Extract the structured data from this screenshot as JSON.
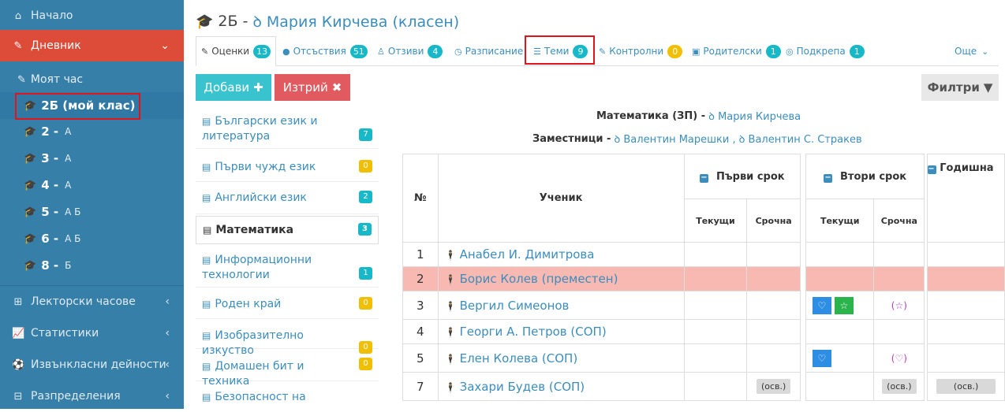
{
  "sidebar": {
    "home": "Начало",
    "diary": "Дневник",
    "my_hour": "Моят час",
    "classes": [
      {
        "num": "2Б (мой клас)",
        "letters": ""
      },
      {
        "num": "2 -",
        "letters": "А"
      },
      {
        "num": "3 -",
        "letters": "А"
      },
      {
        "num": "4 -",
        "letters": "А"
      },
      {
        "num": "5 -",
        "letters": "А Б"
      },
      {
        "num": "6 -",
        "letters": "А Б"
      },
      {
        "num": "8 -",
        "letters": "Б"
      }
    ],
    "lecture": "Лекторски часове",
    "stats": "Статистики",
    "extra": "Извънкласни дейности",
    "distrib": "Разпределения"
  },
  "header": {
    "cls": "2Б -",
    "teacher": "Мария Кирчева (класен)"
  },
  "tabs": [
    {
      "label": "Оценки",
      "badge": "13"
    },
    {
      "label": "Отсъствия",
      "badge": "51"
    },
    {
      "label": "Отзиви",
      "badge": "4"
    },
    {
      "label": "Разписание",
      "badge": ""
    },
    {
      "label": "Теми",
      "badge": "9"
    },
    {
      "label": "Контролни",
      "badge": "0"
    },
    {
      "label": "Родителски",
      "badge": "1"
    },
    {
      "label": "Подкрепа",
      "badge": "1"
    },
    {
      "label": "Още",
      "badge": ""
    }
  ],
  "buttons": {
    "add": "Добави",
    "delete": "Изтрий",
    "filter": "Филтри"
  },
  "subjects": [
    {
      "name": "Български език и литература",
      "badge": "7"
    },
    {
      "name": "Първи чужд език",
      "badge": "0"
    },
    {
      "name": "Английски език",
      "badge": "2"
    },
    {
      "name": "Математика",
      "badge": "3"
    },
    {
      "name": "Информационни технологии",
      "badge": "1"
    },
    {
      "name": "Роден край",
      "badge": "0"
    },
    {
      "name": "Изобразително изкуство",
      "badge": "0"
    },
    {
      "name": "Домашен бит и техника",
      "badge": "0"
    },
    {
      "name": "Безопасност на",
      "badge": ""
    }
  ],
  "subject_info": {
    "label": "Математика (ЗП) -",
    "teacher": "Мария Кирчева",
    "subs_label": "Заместници -",
    "subs1": "Валентин Марешки ,",
    "subs2": "Валентин С. Стракев"
  },
  "table": {
    "h_num": "№",
    "h_student": "Ученик",
    "h_term1": "Първи срок",
    "h_term2": "Втори срок",
    "h_year": "Годишна",
    "h_current": "Текущи",
    "h_term_grade": "Срочна",
    "students": [
      {
        "n": "1",
        "name": "Анабел И. Димитрова"
      },
      {
        "n": "2",
        "name": "Борис Колев (преместен)"
      },
      {
        "n": "3",
        "name": "Вергил Симеонов"
      },
      {
        "n": "4",
        "name": "Георги А. Петров (СОП)"
      },
      {
        "n": "5",
        "name": "Елен Колева (СОП)"
      },
      {
        "n": "7",
        "name": "Захари Будев (СОП)"
      }
    ],
    "osv": "(осв.)",
    "star_paren": "(☆)",
    "heart_paren": "(♡)"
  },
  "colors": {
    "sidebar": "#367fa9",
    "active": "#dd4b39",
    "accent": "#3c8dbc",
    "highlight": "#e0141a"
  }
}
